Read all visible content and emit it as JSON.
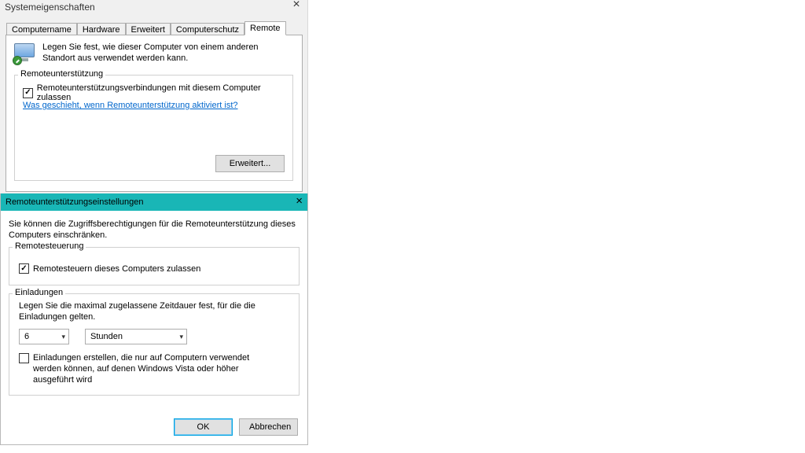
{
  "window1": {
    "title": "Systemeigenschaften",
    "tabs": [
      "Computername",
      "Hardware",
      "Erweitert",
      "Computerschutz",
      "Remote"
    ],
    "active_tab_index": 4,
    "body": {
      "desc": "Legen Sie fest, wie dieser Computer von einem anderen Standort aus verwendet werden kann.",
      "fieldset": {
        "legend": "Remoteunterstützung",
        "checkbox_label": "Remoteunterstützungsverbindungen mit diesem Computer zulassen",
        "checkbox_checked": true,
        "link": "Was geschieht, wenn Remoteunterstützung aktiviert ist?",
        "button": "Erweitert..."
      }
    }
  },
  "window2": {
    "title": "Remoteunterstützungseinstellungen",
    "desc": "Sie können die Zugriffsberechtigungen für die Remoteunterstützung dieses Computers einschränken.",
    "fieldset_control": {
      "legend": "Remotesteuerung",
      "checkbox_label": "Remotesteuern dieses Computers zulassen",
      "checkbox_checked": true
    },
    "fieldset_invite": {
      "legend": "Einladungen",
      "desc": "Legen Sie die maximal zugelassene Zeitdauer fest, für die die Einladungen gelten.",
      "value_amount": "6",
      "value_unit": "Stunden",
      "vista_checkbox_label": "Einladungen erstellen, die nur auf Computern verwendet werden können, auf denen Windows Vista oder höher ausgeführt wird",
      "vista_checkbox_checked": false
    },
    "buttons": {
      "ok": "OK",
      "cancel": "Abbrechen"
    }
  }
}
